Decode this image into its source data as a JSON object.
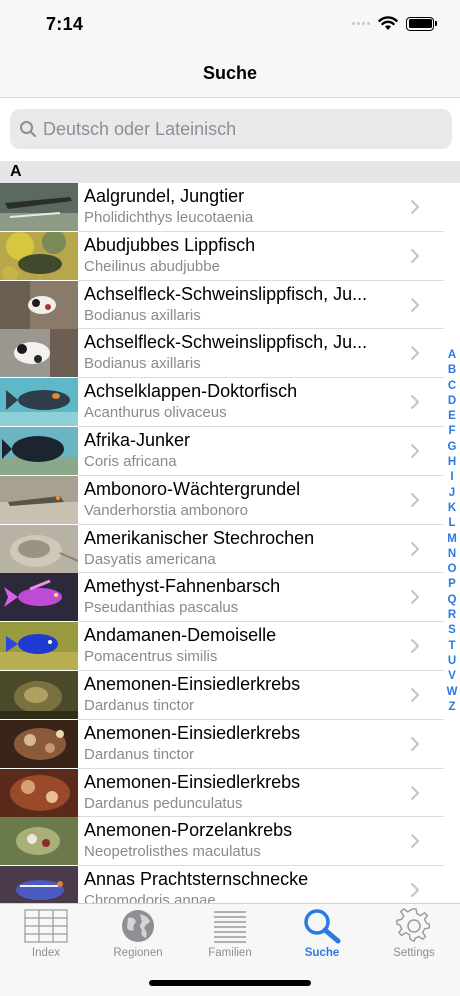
{
  "status": {
    "time": "7:14"
  },
  "nav": {
    "title": "Suche"
  },
  "search": {
    "placeholder": "Deutsch oder Lateinisch",
    "value": ""
  },
  "section": {
    "letter": "A"
  },
  "rows": [
    {
      "title": "Aalgrundel, Jungtier",
      "subtitle": "Pholidichthys leucotaenia",
      "thumb": "photo-1"
    },
    {
      "title": "Abudjubbes Lippfisch",
      "subtitle": "Cheilinus abudjubbe",
      "thumb": "photo-2"
    },
    {
      "title": "Achselfleck-Schweinslippfisch, Ju...",
      "subtitle": "Bodianus axillaris",
      "thumb": "photo-3"
    },
    {
      "title": "Achselfleck-Schweinslippfisch, Ju...",
      "subtitle": "Bodianus axillaris",
      "thumb": "photo-4"
    },
    {
      "title": "Achselklappen-Doktorfisch",
      "subtitle": "Acanthurus olivaceus",
      "thumb": "photo-5"
    },
    {
      "title": "Afrika-Junker",
      "subtitle": "Coris africana",
      "thumb": "photo-6"
    },
    {
      "title": "Ambonoro-Wächtergrundel",
      "subtitle": "Vanderhorstia ambonoro",
      "thumb": "photo-7"
    },
    {
      "title": "Amerikanischer Stechrochen",
      "subtitle": "Dasyatis americana",
      "thumb": "photo-8"
    },
    {
      "title": "Amethyst-Fahnenbarsch",
      "subtitle": "Pseudanthias pascalus",
      "thumb": "photo-9"
    },
    {
      "title": "Andamanen-Demoiselle",
      "subtitle": "Pomacentrus similis",
      "thumb": "photo-10"
    },
    {
      "title": "Anemonen-Einsiedlerkrebs",
      "subtitle": "Dardanus tinctor",
      "thumb": "photo-11"
    },
    {
      "title": "Anemonen-Einsiedlerkrebs",
      "subtitle": "Dardanus tinctor",
      "thumb": "photo-12"
    },
    {
      "title": "Anemonen-Einsiedlerkrebs",
      "subtitle": "Dardanus pedunculatus",
      "thumb": "photo-13"
    },
    {
      "title": "Anemonen-Porzelankrebs",
      "subtitle": "Neopetrolisthes maculatus",
      "thumb": "photo-14"
    },
    {
      "title": "Annas Prachtsternschnecke",
      "subtitle": "Chromodoris annae",
      "thumb": "photo-15"
    }
  ],
  "index_letters": [
    "A",
    "B",
    "C",
    "D",
    "E",
    "F",
    "G",
    "H",
    "I",
    "J",
    "K",
    "L",
    "M",
    "N",
    "O",
    "P",
    "Q",
    "R",
    "S",
    "T",
    "U",
    "V",
    "W",
    "Z"
  ],
  "tabs": [
    {
      "label": "Index",
      "icon": "grid-icon",
      "active": false
    },
    {
      "label": "Regionen",
      "icon": "globe-icon",
      "active": false
    },
    {
      "label": "Familien",
      "icon": "list-lines-icon",
      "active": false
    },
    {
      "label": "Suche",
      "icon": "search-icon",
      "active": true
    },
    {
      "label": "Settings",
      "icon": "gear-icon",
      "active": false
    }
  ],
  "colors": {
    "accent": "#2a7ae2",
    "inactive": "#8e8e93",
    "subtitle": "#8a8a8e",
    "section_bg": "#e6e6e8"
  }
}
